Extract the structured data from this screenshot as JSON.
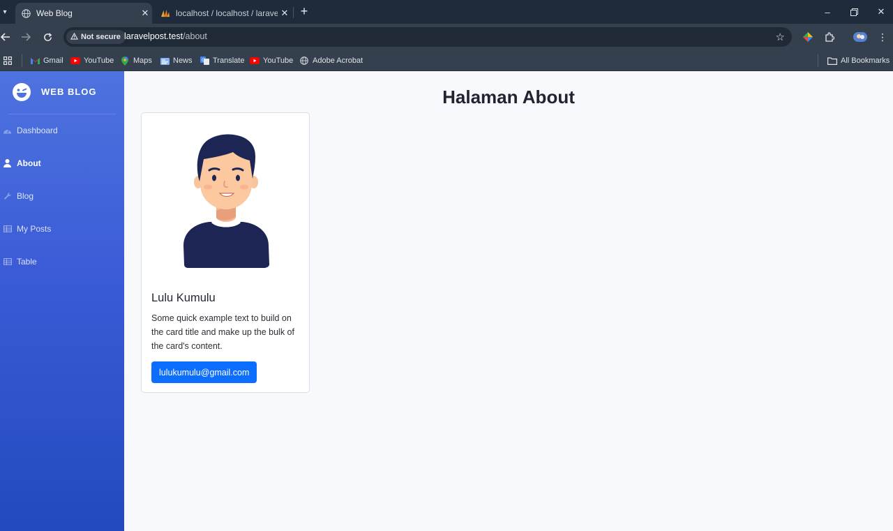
{
  "browser": {
    "tabs": [
      {
        "title": "Web Blog",
        "active": true
      },
      {
        "title": "localhost / localhost / laravelpo",
        "active": false
      }
    ],
    "address": {
      "security_label": "Not secure",
      "host": "laravelpost.test",
      "path": "/about"
    },
    "bookmarks": [
      {
        "label": "Gmail",
        "icon": "gmail-icon"
      },
      {
        "label": "YouTube",
        "icon": "youtube-icon"
      },
      {
        "label": "Maps",
        "icon": "maps-icon"
      },
      {
        "label": "News",
        "icon": "news-icon"
      },
      {
        "label": "Translate",
        "icon": "translate-icon"
      },
      {
        "label": "YouTube",
        "icon": "youtube-icon"
      },
      {
        "label": "Adobe Acrobat",
        "icon": "globe-icon"
      }
    ],
    "all_bookmarks_label": "All Bookmarks"
  },
  "sidebar": {
    "brand": "WEB BLOG",
    "items": [
      {
        "label": "Dashboard",
        "icon": "tachometer-icon",
        "active": false
      },
      {
        "label": "About",
        "icon": "user-icon",
        "active": true
      },
      {
        "label": "Blog",
        "icon": "wrench-icon",
        "active": false
      },
      {
        "label": "My Posts",
        "icon": "table-icon",
        "active": false
      },
      {
        "label": "Table",
        "icon": "table-icon",
        "active": false
      }
    ]
  },
  "main": {
    "title": "Halaman About",
    "card": {
      "name": "Lulu Kumulu",
      "text": "Some quick example text to build on the card title and make up the bulk of the card's content.",
      "email": "lulukumulu@gmail.com"
    }
  },
  "colors": {
    "sidebar_top": "#4e73df",
    "sidebar_bottom": "#224abe",
    "primary_button": "#0d6efd",
    "page_bg": "#f8f9fc"
  }
}
